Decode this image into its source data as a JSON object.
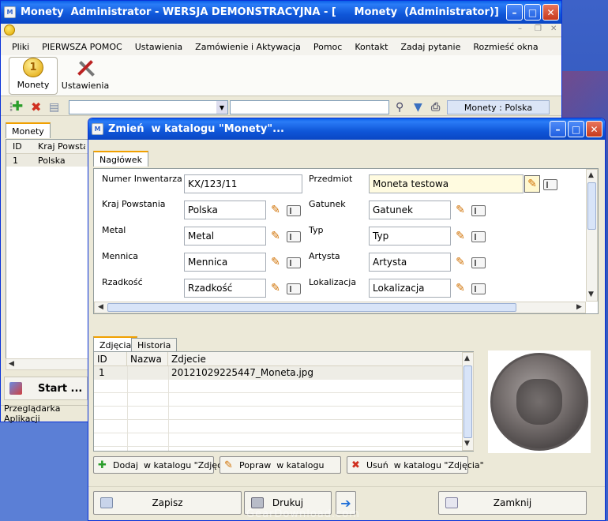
{
  "main_window": {
    "title": "Monety  Administrator - WERSJA DEMONSTRACYJNA - [     Monety  (Administrator)]",
    "menu": [
      "Pliki",
      "PIERWSZA POMOC",
      "Ustawienia",
      "Zamówienie i Aktywacja",
      "Pomoc",
      "Kontakt",
      "Zadaj pytanie",
      "Rozmieść okna"
    ],
    "ribbon": {
      "monety_label": "Monety",
      "ustawienia_label": "Ustawienia"
    },
    "toolbar_status": "Monety : Polska",
    "left_panel": {
      "tab_label": "Monety",
      "columns": [
        "ID",
        "Kraj Powstania"
      ],
      "rows": [
        {
          "id": "1",
          "kraj": "Polska"
        }
      ]
    },
    "start_label": "Start ...",
    "status_bar": "Przeglądarka Aplikacji"
  },
  "dialog": {
    "title": "Zmień  w katalogu \"Monety\"...",
    "header_tab": "Nagłówek",
    "fields": {
      "numer_label": "Numer Inwentarza",
      "numer_value": "KX/123/11",
      "przedmiot_label": "Przedmiot",
      "przedmiot_value": "Moneta testowa",
      "kraj_label": "Kraj Powstania",
      "kraj_value": "Polska",
      "gatunek_label": "Gatunek",
      "gatunek_value": "Gatunek",
      "metal_label": "Metal",
      "metal_value": "Metal",
      "typ_label": "Typ",
      "typ_value": "Typ",
      "mennica_label": "Mennica",
      "mennica_value": "Mennica",
      "artysta_label": "Artysta",
      "artysta_value": "Artysta",
      "rzadkosc_label": "Rzadkość",
      "rzadkosc_value": "Rzadkość",
      "lokalizacja_label": "Lokalizacja",
      "lokalizacja_value": "Lokalizacja"
    },
    "photo_tabs": [
      "Zdjęcia",
      "Historia"
    ],
    "photo_grid": {
      "columns": [
        "ID",
        "Nazwa",
        "Zdjecie"
      ],
      "rows": [
        {
          "id": "1",
          "nazwa": "",
          "zdjecie": "20121029225447_Moneta.jpg"
        }
      ]
    },
    "actions": {
      "add": "Dodaj  w katalogu \"Zdjęcia\"",
      "edit": "Popraw  w katalogu",
      "delete": "Usuń  w katalogu \"Zdjęcia\""
    },
    "buttons": {
      "save": "Zapisz",
      "print": "Drukuj",
      "close": "Zamknij"
    }
  },
  "watermark": "GearDownload.com",
  "colors": {
    "title_blue": "#0a5fe8",
    "tab_accent": "#f0a000",
    "desktop": "#3d62c8"
  }
}
